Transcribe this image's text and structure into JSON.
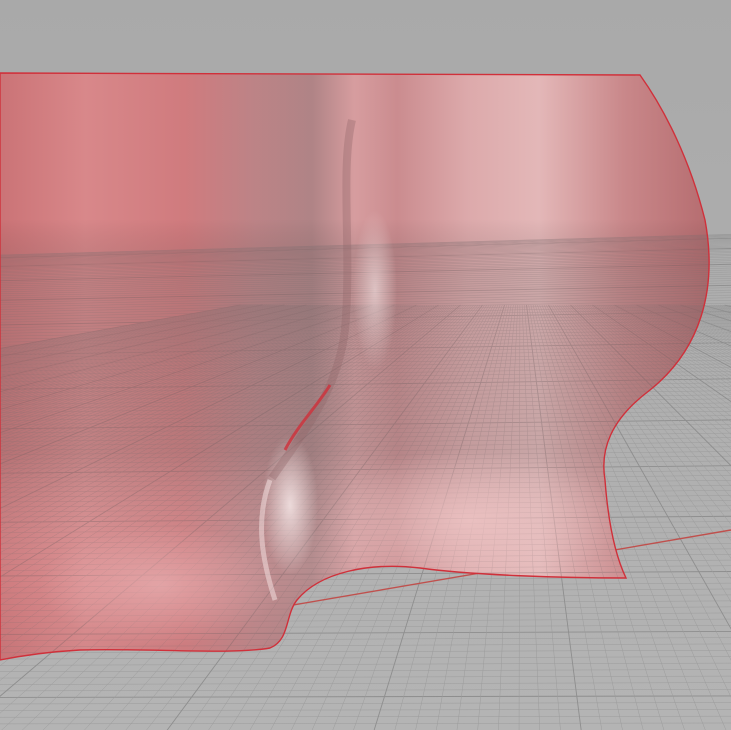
{
  "viewport": {
    "label": "",
    "background_color": "#a8a8a8",
    "grid": {
      "visible": true,
      "minor_line_color": "#9c9c9c",
      "major_line_color": "#8e8e8e",
      "x_axis_color": "#c0504d",
      "y_axis_color": "#7a8a3a"
    },
    "surface": {
      "name": "",
      "selected": true,
      "fill_color": "#d47a7e",
      "highlight_color": "#e9bcbd",
      "shadow_color": "#9a6c6e",
      "edge_color": "#d0303a"
    }
  }
}
